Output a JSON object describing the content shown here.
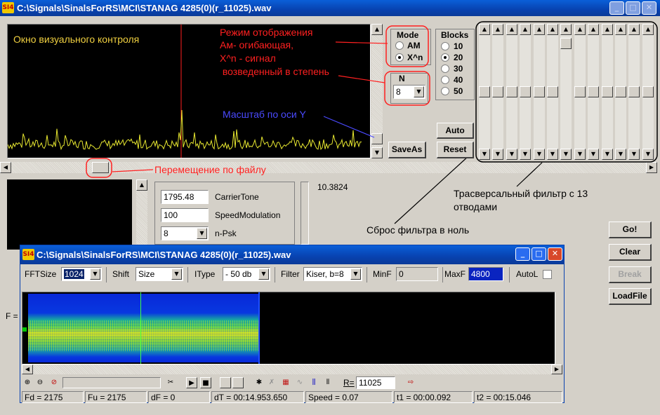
{
  "window": {
    "icon_text": "SI4",
    "title": "C:\\Signals\\SinalsForRS\\MCI\\STANAG 4285(0)(r_11025).wav",
    "min": "_",
    "max": "□",
    "close": "✕"
  },
  "display": {
    "label": "Окно визуального контроля"
  },
  "annotations": {
    "mode_note": [
      "Режим отображения",
      "Ам- огибающая,",
      "X^n - сигнал",
      " возведенный в степень"
    ],
    "scale_note": "Масштаб по оси Y",
    "move_note": "Перемещение по файлу",
    "filter_note": [
      "Трасверсальный фильтр с 13",
      "отводами"
    ],
    "reset_note": "Сброс фильтра в ноль"
  },
  "mode": {
    "title": "Mode",
    "options": [
      "AM",
      "X^n"
    ],
    "selected": "X^n"
  },
  "blocks": {
    "title": "Blocks",
    "options": [
      "10",
      "20",
      "30",
      "40",
      "50"
    ],
    "selected": "20"
  },
  "n": {
    "label": "N",
    "value": "8"
  },
  "buttons": {
    "auto": "Auto",
    "saveas": "SaveAs",
    "reset": "Reset",
    "go": "Go!",
    "clear": "Clear",
    "break": "Break",
    "loadfile": "LoadFile"
  },
  "params": {
    "carrier_value": "1795.48",
    "carrier_label": "CarrierTone",
    "speed_value": "100",
    "speed_label": "SpeedModulation",
    "npsk_value": "8",
    "npsk_label": "n-Psk",
    "readout": "10.3824",
    "f_label": "F ="
  },
  "filter": {
    "tap_count": 13
  },
  "child": {
    "icon_text": "SI4",
    "title": "C:\\Signals\\SinalsForRS\\MCI\\STANAG 4285(0)(r_11025).wav",
    "fftsize_label": "FFTSize",
    "fftsize_value": "1024",
    "shift_label": "Shift",
    "shift_value": "Size",
    "itype_label": "IType",
    "itype_value": "- 50 db",
    "filter_label": "Filter",
    "filter_value": "Kiser, b=8",
    "minf_label": "MinF",
    "minf_value": "0",
    "maxf_label": "MaxF",
    "maxf_value": "4800",
    "autol_label": "AutoL",
    "r_label": "R=",
    "r_value": "11025",
    "status": [
      "Fd = 2175",
      "Fu = 2175",
      "dF = 0",
      "dT = 00:14.953.650",
      "Speed = 0.07",
      "t1 = 00:00.092",
      "t2 = 00:15.046"
    ]
  },
  "colors": {
    "titlebar": "#0a5fd8",
    "annotation_red": "#ff2020",
    "annotation_blue": "#4a4aff",
    "trace_yellow": "#e8e830",
    "display_label": "#f0d040"
  }
}
